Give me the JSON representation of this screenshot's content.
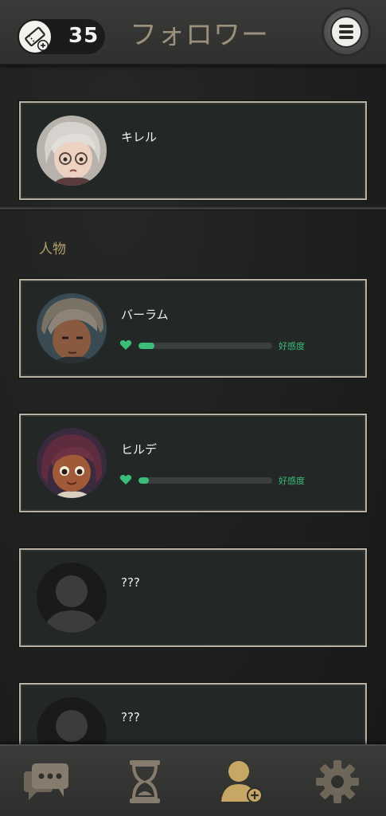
{
  "header": {
    "ticket_count": "35",
    "title": "フォロワー"
  },
  "pinned": {
    "name": "キレル"
  },
  "section": {
    "label": "人物"
  },
  "characters": [
    {
      "name": "バーラム",
      "affection_label": "好感度",
      "affection": 0.12
    },
    {
      "name": "ヒルデ",
      "affection_label": "好感度",
      "affection": 0.08
    },
    {
      "name": "???"
    },
    {
      "name": "???"
    }
  ],
  "nav": {
    "active": "followers",
    "items": [
      "chat",
      "history",
      "followers",
      "settings"
    ]
  },
  "colors": {
    "accent": "#3bbd7a",
    "gold": "#c8a764",
    "title": "#9a907c"
  }
}
